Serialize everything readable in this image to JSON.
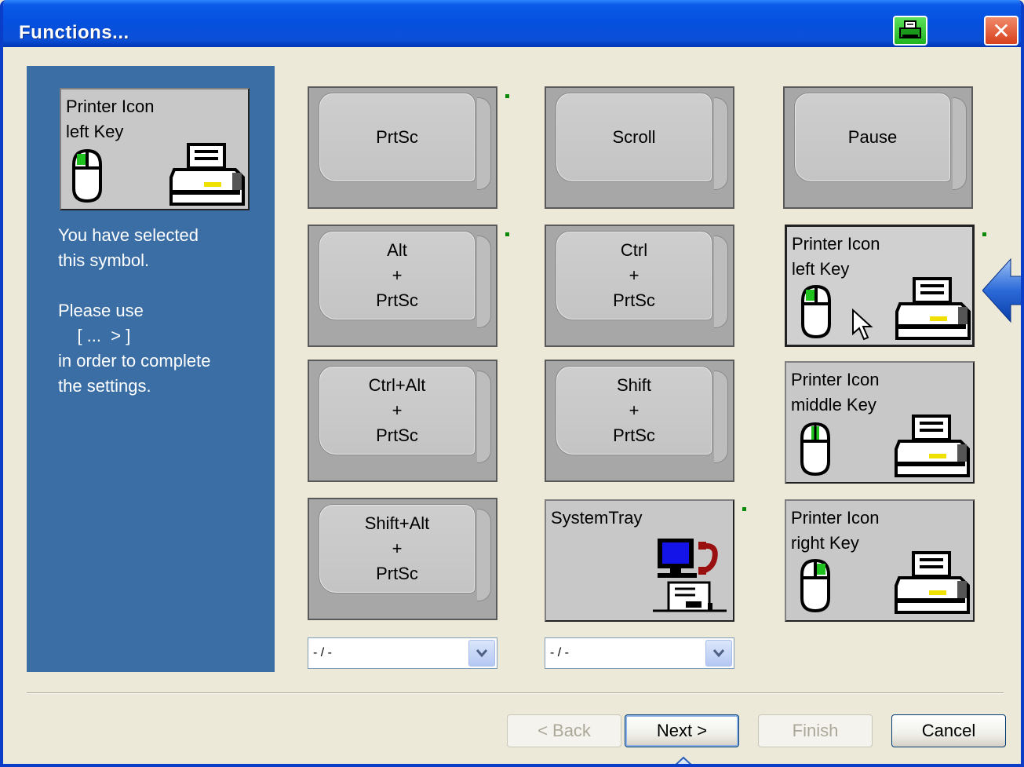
{
  "window": {
    "title": "Functions..."
  },
  "titlebar": {
    "print_icon": "printer-icon",
    "close_icon": "close-icon"
  },
  "left_panel": {
    "selected_tile": {
      "label_line1": "Printer Icon",
      "label_line2": "left Key"
    },
    "info_lines": [
      "You have selected",
      "this symbol.",
      "",
      "Please use",
      "    [ ...  > ]",
      "in order to complete",
      "the settings."
    ]
  },
  "keys": {
    "prtsc": {
      "lines": [
        "PrtSc"
      ]
    },
    "scroll": {
      "lines": [
        "Scroll"
      ]
    },
    "pause": {
      "lines": [
        "Pause"
      ]
    },
    "alt_prtsc": {
      "lines": [
        "Alt",
        "+",
        "PrtSc"
      ]
    },
    "ctrl_prtsc": {
      "lines": [
        "Ctrl",
        "+",
        "PrtSc"
      ]
    },
    "ctrlalt_prtsc": {
      "lines": [
        "Ctrl+Alt",
        "+",
        "PrtSc"
      ]
    },
    "shift_prtsc": {
      "lines": [
        "Shift",
        "+",
        "PrtSc"
      ]
    },
    "shiftalt_prtsc": {
      "lines": [
        "Shift+Alt",
        "+",
        "PrtSc"
      ]
    }
  },
  "tiles": {
    "printer_left": {
      "line1": "Printer Icon",
      "line2": "left Key"
    },
    "printer_middle": {
      "line1": "Printer Icon",
      "line2": "middle Key"
    },
    "printer_right": {
      "line1": "Printer Icon",
      "line2": "right Key"
    },
    "system_tray": {
      "label": "SystemTray"
    }
  },
  "combos": [
    {
      "value": "- / -"
    },
    {
      "value": "- / -"
    }
  ],
  "buttons": {
    "back": "< Back",
    "next": "Next >",
    "finish": "Finish",
    "cancel": "Cancel"
  },
  "colors": {
    "panel": "#3a6ea5",
    "titlebar": "#0550e0",
    "indicator_green": "#0a8a0a"
  }
}
